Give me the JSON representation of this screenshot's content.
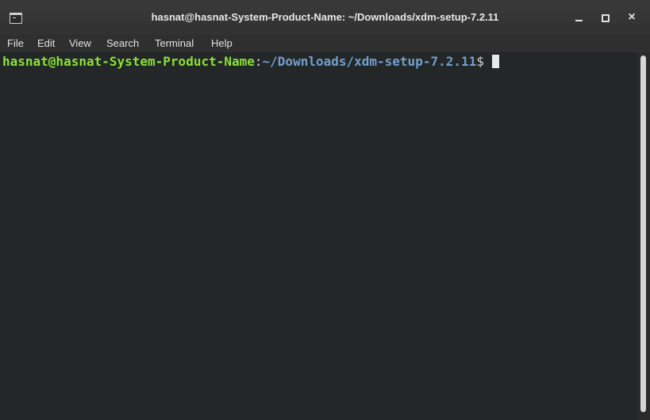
{
  "window": {
    "title": "hasnat@hasnat-System-Product-Name: ~/Downloads/xdm-setup-7.2.11",
    "close_glyph": "×"
  },
  "menu": {
    "items": [
      "File",
      "Edit",
      "View",
      "Search",
      "Terminal",
      "Help"
    ]
  },
  "terminal": {
    "prompt_user_host": "hasnat@hasnat-System-Product-Name",
    "prompt_colon": ":",
    "prompt_path": "~/Downloads/xdm-setup-7.2.11",
    "prompt_symbol": "$ "
  },
  "colors": {
    "user_host": "#8ae234",
    "path": "#729fcf",
    "background": "#232728"
  }
}
